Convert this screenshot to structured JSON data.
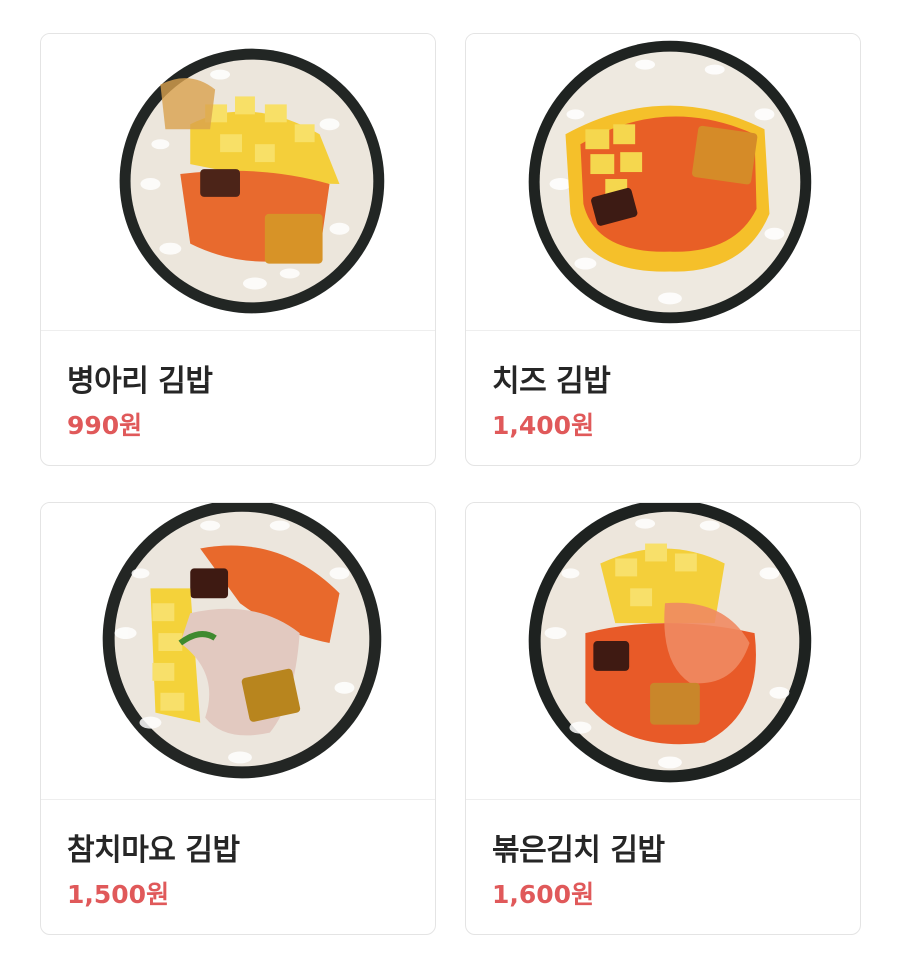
{
  "theme": {
    "price_color": "#e0595a",
    "name_color": "#262626"
  },
  "menu": {
    "items": [
      {
        "name": "병아리 김밥",
        "price": "990원",
        "image": "gimbap-egg-photo"
      },
      {
        "name": "치즈 김밥",
        "price": "1,400원",
        "image": "gimbap-cheese-photo"
      },
      {
        "name": "참치마요 김밥",
        "price": "1,500원",
        "image": "gimbap-tuna-mayo-photo"
      },
      {
        "name": "볶은김치 김밥",
        "price": "1,600원",
        "image": "gimbap-kimchi-photo"
      }
    ]
  }
}
